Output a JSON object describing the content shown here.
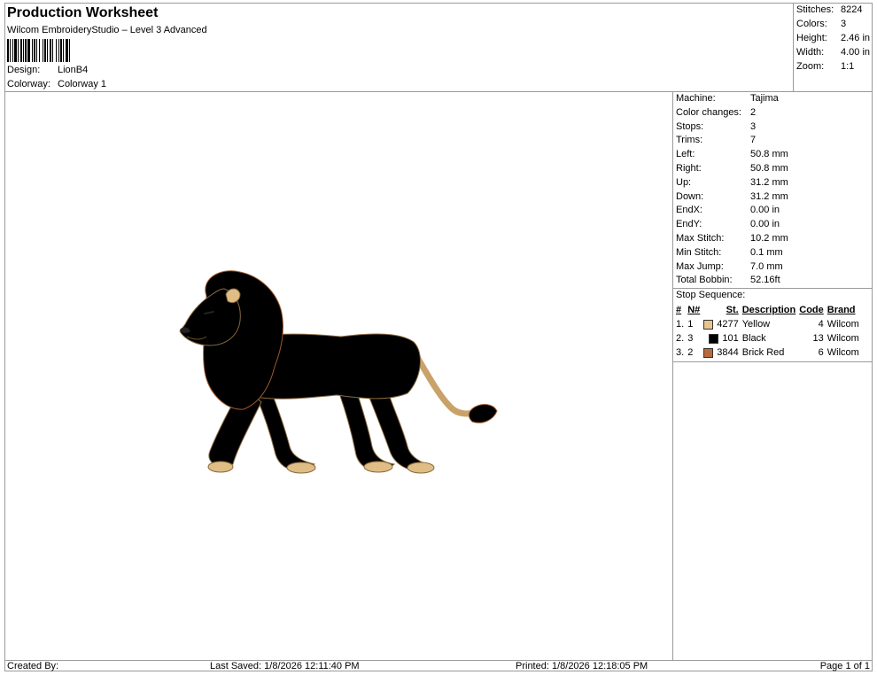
{
  "header": {
    "title": "Production Worksheet",
    "subtitle": "Wilcom EmbroideryStudio – Level 3 Advanced",
    "design_label": "Design:",
    "design_value": "LionB4",
    "colorway_label": "Colorway:",
    "colorway_value": "Colorway 1"
  },
  "stats": [
    {
      "label": "Stitches:",
      "value": "8224"
    },
    {
      "label": "Colors:",
      "value": "3"
    },
    {
      "label": "Height:",
      "value": "2.46 in"
    },
    {
      "label": "Width:",
      "value": "4.00 in"
    },
    {
      "label": "Zoom:",
      "value": "1:1"
    }
  ],
  "machine_info": [
    {
      "label": "Machine:",
      "value": "Tajima"
    },
    {
      "label": "Color changes:",
      "value": "2"
    },
    {
      "label": "Stops:",
      "value": "3"
    },
    {
      "label": "Trims:",
      "value": "7"
    },
    {
      "label": "Left:",
      "value": "50.8 mm"
    },
    {
      "label": "Right:",
      "value": "50.8 mm"
    },
    {
      "label": "Up:",
      "value": "31.2 mm"
    },
    {
      "label": "Down:",
      "value": "31.2 mm"
    },
    {
      "label": "EndX:",
      "value": "0.00 in"
    },
    {
      "label": "EndY:",
      "value": "0.00 in"
    },
    {
      "label": "Max Stitch:",
      "value": "10.2 mm"
    },
    {
      "label": "Min Stitch:",
      "value": "0.1 mm"
    },
    {
      "label": "Max Jump:",
      "value": "7.0 mm"
    },
    {
      "label": "Total Bobbin:",
      "value": "52.16ft"
    }
  ],
  "stop_sequence": {
    "title": "Stop Sequence:",
    "headers": {
      "num": "#",
      "n": "N#",
      "st": "St.",
      "desc": "Description",
      "code": "Code",
      "brand": "Brand"
    },
    "rows": [
      {
        "num": "1.",
        "n": "1",
        "color": "#e8c48d",
        "st": "4277",
        "desc": "Yellow",
        "code": "4",
        "brand": "Wilcom"
      },
      {
        "num": "2.",
        "n": "3",
        "color": "#000000",
        "st": "101",
        "desc": "Black",
        "code": "13",
        "brand": "Wilcom"
      },
      {
        "num": "3.",
        "n": "2",
        "color": "#b86a3c",
        "st": "3844",
        "desc": "Brick Red",
        "code": "6",
        "brand": "Wilcom"
      }
    ]
  },
  "design_colors": {
    "body": "#dfbd85",
    "body_shade": "#c9a26a",
    "mane": "#c67a42",
    "mane_dark": "#9e5a2c",
    "outline": "#8a6a3e",
    "eye": "#222222"
  },
  "footer": {
    "created_by": "Created By:",
    "last_saved": "Last Saved: 1/8/2026 12:11:40 PM",
    "printed": "Printed: 1/8/2026 12:18:05 PM",
    "page": "Page 1 of 1"
  }
}
